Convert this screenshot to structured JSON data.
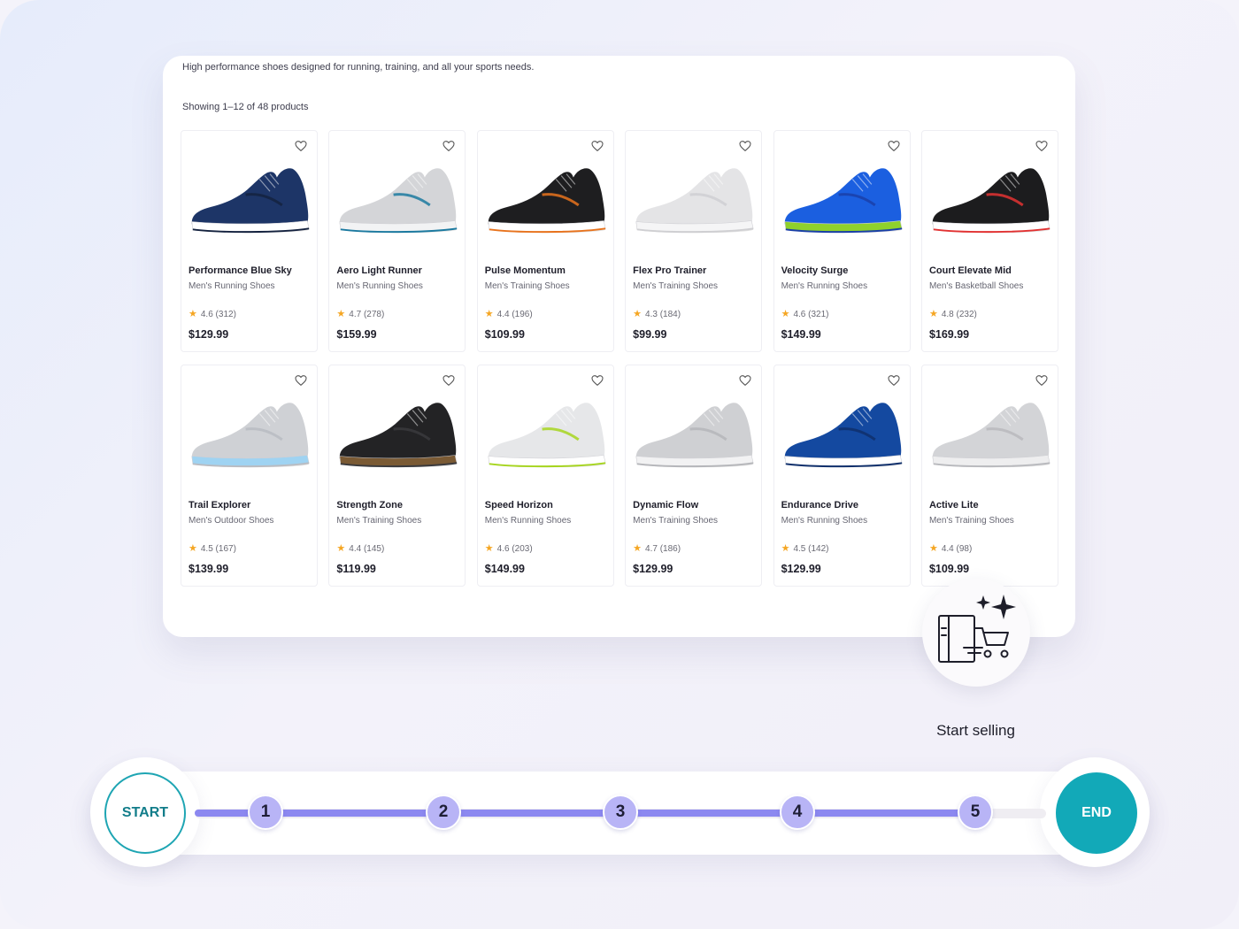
{
  "catalog": {
    "subtitle": "High performance shoes designed for running, training, and all your sports needs.",
    "count_text": "Showing 1–12 of 48 products",
    "products": [
      {
        "name": "Performance Blue Sky",
        "category": "Men's Running Shoes",
        "rating": "4.6 (312)",
        "price": "$129.99",
        "upper": "#1d3567",
        "sole": "#ffffff",
        "accent": "#14223f"
      },
      {
        "name": "Aero Light Runner",
        "category": "Men's Running Shoes",
        "rating": "4.7 (278)",
        "price": "$159.99",
        "upper": "#d4d5d8",
        "sole": "#f2f3f4",
        "accent": "#1c7aa0"
      },
      {
        "name": "Pulse Momentum",
        "category": "Men's Training Shoes",
        "rating": "4.4 (196)",
        "price": "$109.99",
        "upper": "#1e1e20",
        "sole": "#ffffff",
        "accent": "#e8731d"
      },
      {
        "name": "Flex Pro Trainer",
        "category": "Men's Training Shoes",
        "rating": "4.3 (184)",
        "price": "$99.99",
        "upper": "#e4e4e6",
        "sole": "#f5f5f6",
        "accent": "#cfcfd2"
      },
      {
        "name": "Velocity Surge",
        "category": "Men's Running Shoes",
        "rating": "4.6 (321)",
        "price": "$149.99",
        "upper": "#1b5fe0",
        "sole": "#8fd12c",
        "accent": "#1a3fa8"
      },
      {
        "name": "Court Elevate Mid",
        "category": "Men's Basketball Shoes",
        "rating": "4.8 (232)",
        "price": "$169.99",
        "upper": "#1c1c1e",
        "sole": "#ffffff",
        "accent": "#e23232"
      },
      {
        "name": "Trail Explorer",
        "category": "Men's Outdoor Shoes",
        "rating": "4.5 (167)",
        "price": "$139.99",
        "upper": "#cfd1d5",
        "sole": "#9fd3f2",
        "accent": "#b9bcc2"
      },
      {
        "name": "Strength Zone",
        "category": "Men's Training Shoes",
        "rating": "4.4 (145)",
        "price": "$119.99",
        "upper": "#232325",
        "sole": "#7a5a34",
        "accent": "#3a3a3d"
      },
      {
        "name": "Speed Horizon",
        "category": "Men's Running Shoes",
        "rating": "4.6 (203)",
        "price": "$149.99",
        "upper": "#e6e7e9",
        "sole": "#ffffff",
        "accent": "#a6d51e"
      },
      {
        "name": "Dynamic Flow",
        "category": "Men's Training Shoes",
        "rating": "4.7 (186)",
        "price": "$129.99",
        "upper": "#cfd0d3",
        "sole": "#f2f2f3",
        "accent": "#b5b6ba"
      },
      {
        "name": "Endurance Drive",
        "category": "Men's Running Shoes",
        "rating": "4.5 (142)",
        "price": "$129.99",
        "upper": "#1449a0",
        "sole": "#ffffff",
        "accent": "#0f2f6b"
      },
      {
        "name": "Active Lite",
        "category": "Men's Training Shoes",
        "rating": "4.4 (98)",
        "price": "$109.99",
        "upper": "#d3d4d7",
        "sole": "#eeeeef",
        "accent": "#b8b9bd"
      }
    ]
  },
  "sell": {
    "label": "Start selling",
    "icon": "store-cart-sparkle-icon"
  },
  "timeline": {
    "start_label": "START",
    "end_label": "END",
    "steps": [
      "1",
      "2",
      "3",
      "4",
      "5"
    ],
    "colors": {
      "track": "#8c88f0",
      "step": "#b8b4f6",
      "teal": "#12a9b8"
    }
  }
}
